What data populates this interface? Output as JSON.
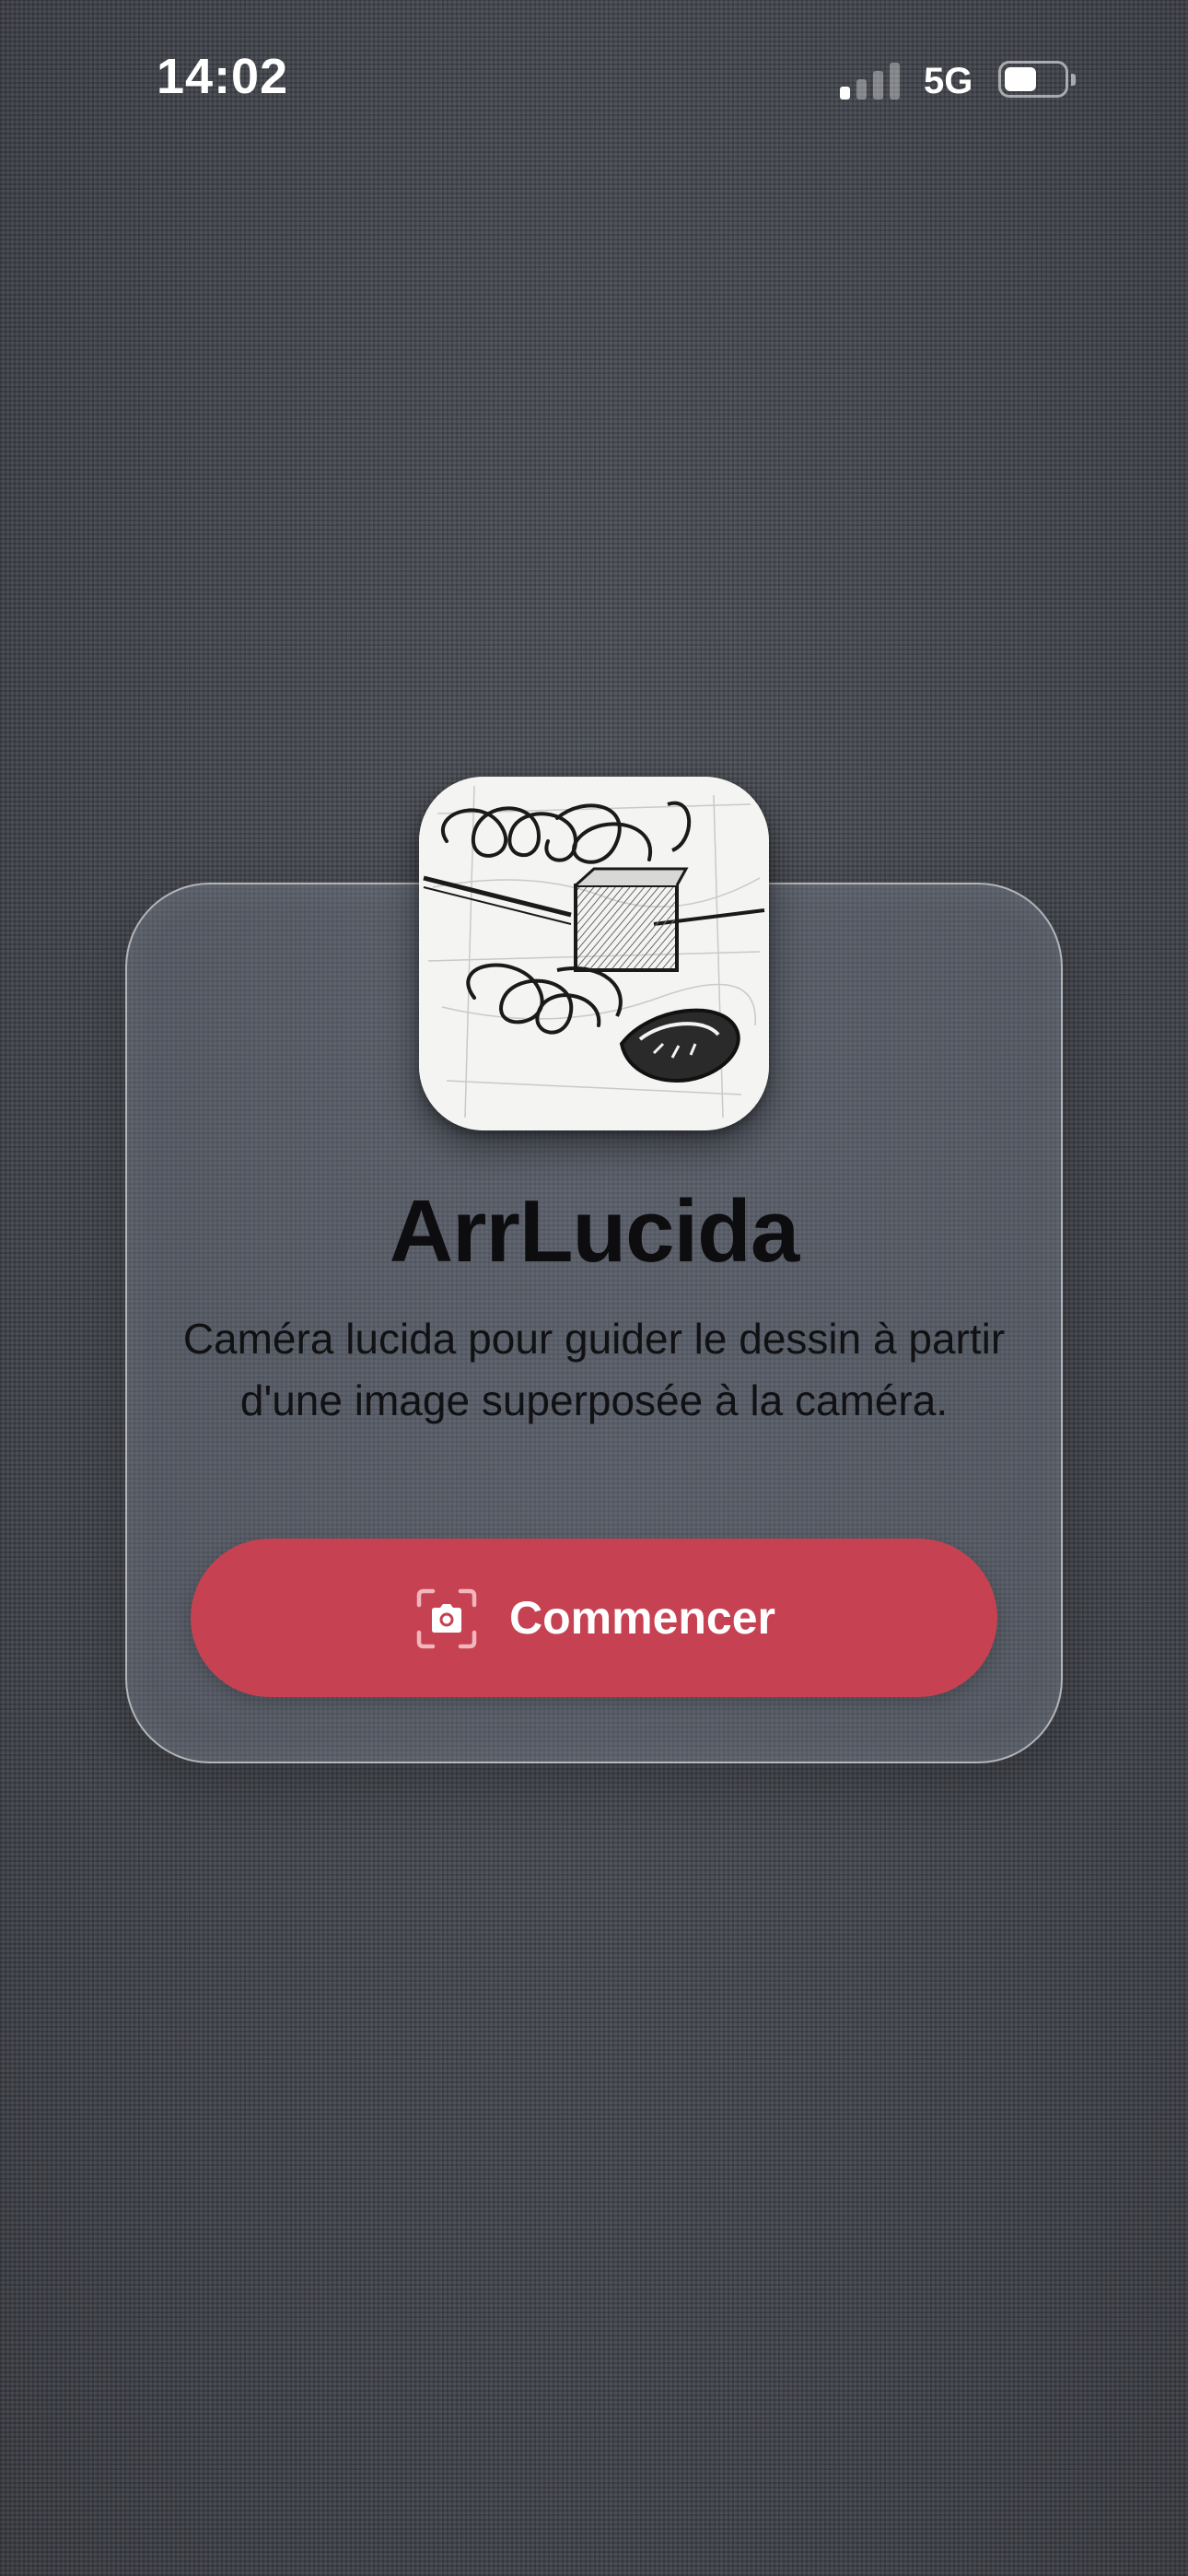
{
  "status_bar": {
    "time": "14:02",
    "network": "5G",
    "signal_bars_active": 1,
    "signal_bars_total": 4,
    "battery_level_fraction": 0.45
  },
  "app": {
    "name": "ArrLucida",
    "description": "Caméra lucida pour guider le dessin à partir d'une image superposée à la caméra.",
    "icon": "sketch-app-icon"
  },
  "actions": {
    "start_label": "Commencer",
    "start_icon": "camera-viewfinder-icon"
  },
  "colors": {
    "accent": "#c64252",
    "background": "#45484f",
    "text_primary": "#0d0d0f",
    "on_accent": "#ffffff"
  }
}
